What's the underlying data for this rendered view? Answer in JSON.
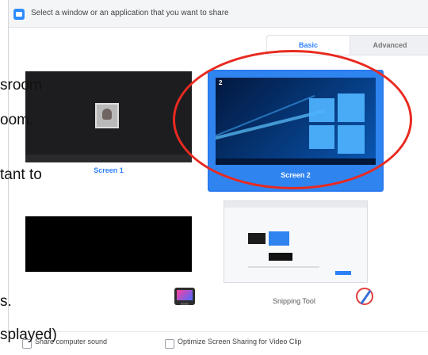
{
  "background_text": {
    "line1": "sroom",
    "line2": "oom.",
    "line3": "tant to",
    "line4": "s.",
    "line5": "splayed)"
  },
  "window": {
    "title": "Select a window or an application that you want to share"
  },
  "tabs": [
    {
      "label": "Basic",
      "selected": true
    },
    {
      "label": "Advanced",
      "selected": false
    }
  ],
  "tiles": [
    {
      "label": "Screen 1",
      "number": "",
      "selected": false
    },
    {
      "label": "Screen 2",
      "number": "2",
      "selected": true
    },
    {
      "label": "",
      "selected": false
    },
    {
      "label": "Snipping Tool",
      "selected": false
    }
  ],
  "options": [
    {
      "label": "Share computer sound",
      "checked": false
    },
    {
      "label": "Optimize Screen Sharing for Video Clip",
      "checked": false
    }
  ],
  "colors": {
    "accent": "#2d7ff9",
    "selected_tile": "#2f84f0",
    "annotation": "#e82a20"
  },
  "icons": [
    "zoom-share-icon",
    "teams-screen-icon",
    "snipping-tool-icon"
  ]
}
